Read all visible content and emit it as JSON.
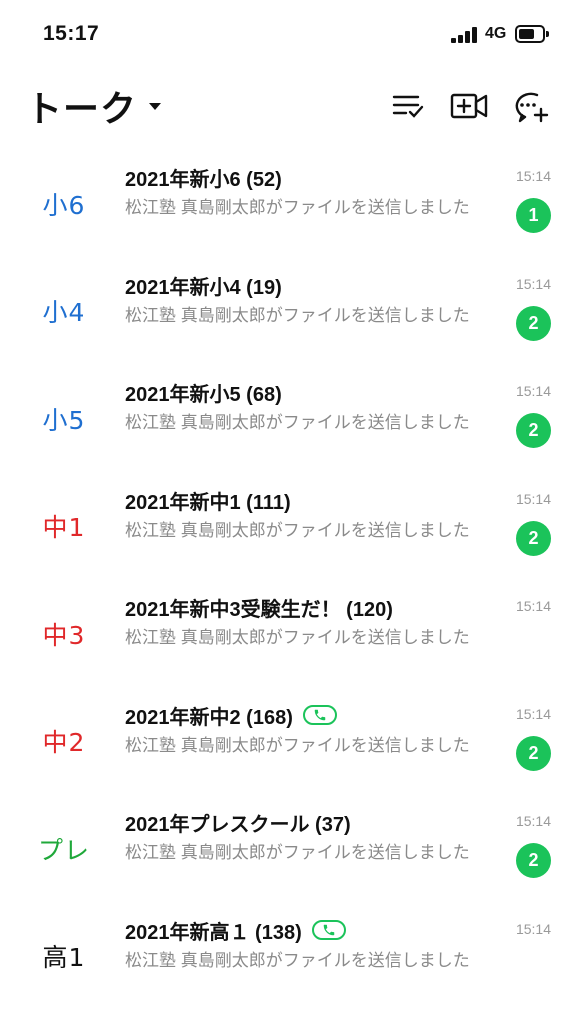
{
  "status_bar": {
    "time": "15:17",
    "network": "4G"
  },
  "header": {
    "title": "トーク"
  },
  "colors": {
    "accent_green": "#1bc35a",
    "blue": "#1f6fd0",
    "red": "#e0282a",
    "green": "#1fa83a",
    "black": "#111111"
  },
  "chats": [
    {
      "thumb": "小6",
      "thumb_color": "#1f6fd0",
      "name": "2021年新小6 (52)",
      "call": false,
      "preview": "松江塾 真島剛太郎がファイルを送信しました",
      "time": "15:14",
      "unread": "1"
    },
    {
      "thumb": "小4",
      "thumb_color": "#1f6fd0",
      "name": "2021年新小4 (19)",
      "call": false,
      "preview": "松江塾 真島剛太郎がファイルを送信しました",
      "time": "15:14",
      "unread": "2"
    },
    {
      "thumb": "小5",
      "thumb_color": "#1f6fd0",
      "name": "2021年新小5 (68)",
      "call": false,
      "preview": "松江塾 真島剛太郎がファイルを送信しました",
      "time": "15:14",
      "unread": "2"
    },
    {
      "thumb": "中1",
      "thumb_color": "#e0282a",
      "name": "2021年新中1 (111)",
      "call": false,
      "preview": "松江塾 真島剛太郎がファイルを送信しました",
      "time": "15:14",
      "unread": "2"
    },
    {
      "thumb": "中3",
      "thumb_color": "#e0282a",
      "name": "2021年新中3受験生だ！ (120)",
      "call": false,
      "preview": "松江塾 真島剛太郎がファイルを送信しました",
      "time": "15:14",
      "unread": ""
    },
    {
      "thumb": "中2",
      "thumb_color": "#e0282a",
      "name": "2021年新中2 (168)",
      "call": true,
      "preview": "松江塾 真島剛太郎がファイルを送信しました",
      "time": "15:14",
      "unread": "2"
    },
    {
      "thumb": "プレ",
      "thumb_color": "#1fa83a",
      "name": "2021年プレスクール (37)",
      "call": false,
      "preview": "松江塾 真島剛太郎がファイルを送信しました",
      "time": "15:14",
      "unread": "2"
    },
    {
      "thumb": "高1",
      "thumb_color": "#111111",
      "name": "2021年新高１ (138)",
      "call": true,
      "preview": "松江塾 真島剛太郎がファイルを送信しました",
      "time": "15:14",
      "unread": ""
    }
  ]
}
